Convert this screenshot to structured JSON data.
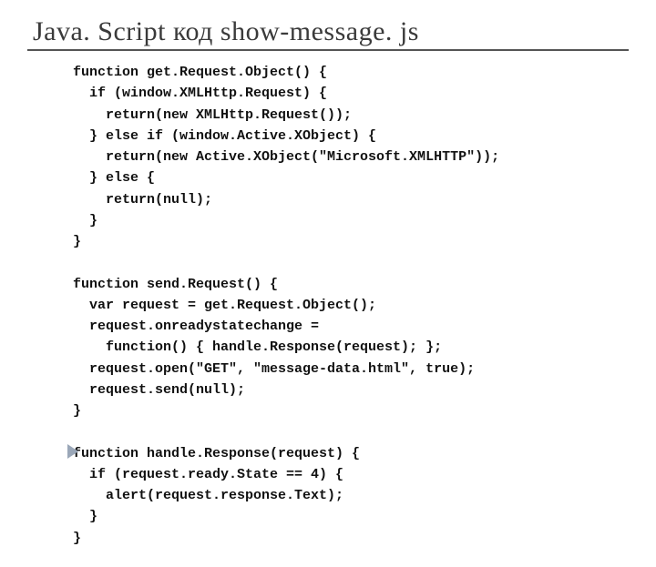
{
  "title": "Java. Script код show-message. js",
  "code": "function get.Request.Object() {\n  if (window.XMLHttp.Request) {\n    return(new XMLHttp.Request());\n  } else if (window.Active.XObject) {\n    return(new Active.XObject(\"Microsoft.XMLHTTP\"));\n  } else {\n    return(null);\n  }\n}\n\nfunction send.Request() {\n  var request = get.Request.Object();\n  request.onreadystatechange =\n    function() { handle.Response(request); };\n  request.open(\"GET\", \"message-data.html\", true);\n  request.send(null);\n}\n\nfunction handle.Response(request) {\n  if (request.ready.State == 4) {\n    alert(request.response.Text);\n  }\n}"
}
